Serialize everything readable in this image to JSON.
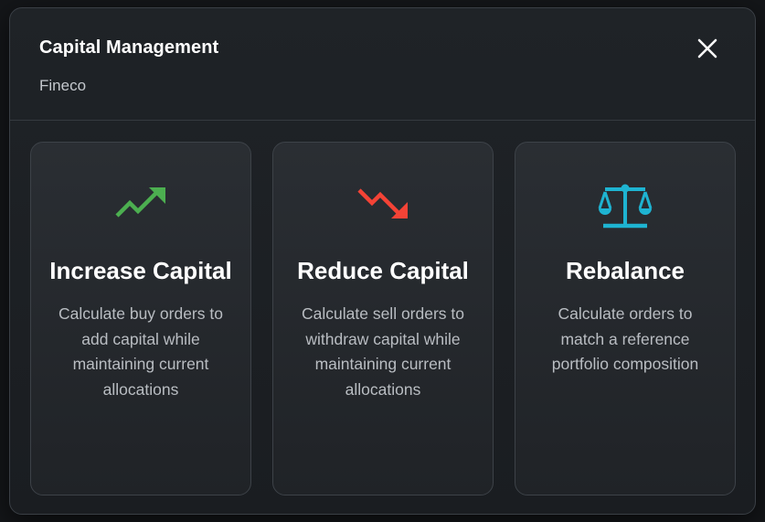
{
  "dialog": {
    "title": "Capital Management",
    "subtitle": "Fineco"
  },
  "cards": [
    {
      "title": "Increase Capital",
      "description": "Calculate buy orders to add capital while maintaining current allocations",
      "icon": "trending-up-icon",
      "color": "#4caf50"
    },
    {
      "title": "Reduce Capital",
      "description": "Calculate sell orders to withdraw capital while maintaining current allocations",
      "icon": "trending-down-icon",
      "color": "#f44336"
    },
    {
      "title": "Rebalance",
      "description": "Calculate orders to match a reference portfolio composition",
      "icon": "scale-icon",
      "color": "#1eb4d2"
    }
  ],
  "colors": {
    "background": "#141619",
    "card_border": "#3d4248"
  }
}
